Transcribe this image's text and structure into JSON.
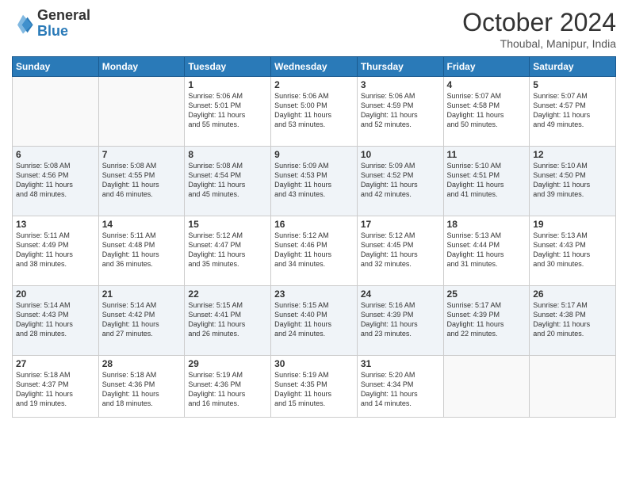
{
  "header": {
    "logo_general": "General",
    "logo_blue": "Blue",
    "month": "October 2024",
    "location": "Thoubal, Manipur, India"
  },
  "weekdays": [
    "Sunday",
    "Monday",
    "Tuesday",
    "Wednesday",
    "Thursday",
    "Friday",
    "Saturday"
  ],
  "weeks": [
    [
      {
        "day": "",
        "info": ""
      },
      {
        "day": "",
        "info": ""
      },
      {
        "day": "1",
        "info": "Sunrise: 5:06 AM\nSunset: 5:01 PM\nDaylight: 11 hours\nand 55 minutes."
      },
      {
        "day": "2",
        "info": "Sunrise: 5:06 AM\nSunset: 5:00 PM\nDaylight: 11 hours\nand 53 minutes."
      },
      {
        "day": "3",
        "info": "Sunrise: 5:06 AM\nSunset: 4:59 PM\nDaylight: 11 hours\nand 52 minutes."
      },
      {
        "day": "4",
        "info": "Sunrise: 5:07 AM\nSunset: 4:58 PM\nDaylight: 11 hours\nand 50 minutes."
      },
      {
        "day": "5",
        "info": "Sunrise: 5:07 AM\nSunset: 4:57 PM\nDaylight: 11 hours\nand 49 minutes."
      }
    ],
    [
      {
        "day": "6",
        "info": "Sunrise: 5:08 AM\nSunset: 4:56 PM\nDaylight: 11 hours\nand 48 minutes."
      },
      {
        "day": "7",
        "info": "Sunrise: 5:08 AM\nSunset: 4:55 PM\nDaylight: 11 hours\nand 46 minutes."
      },
      {
        "day": "8",
        "info": "Sunrise: 5:08 AM\nSunset: 4:54 PM\nDaylight: 11 hours\nand 45 minutes."
      },
      {
        "day": "9",
        "info": "Sunrise: 5:09 AM\nSunset: 4:53 PM\nDaylight: 11 hours\nand 43 minutes."
      },
      {
        "day": "10",
        "info": "Sunrise: 5:09 AM\nSunset: 4:52 PM\nDaylight: 11 hours\nand 42 minutes."
      },
      {
        "day": "11",
        "info": "Sunrise: 5:10 AM\nSunset: 4:51 PM\nDaylight: 11 hours\nand 41 minutes."
      },
      {
        "day": "12",
        "info": "Sunrise: 5:10 AM\nSunset: 4:50 PM\nDaylight: 11 hours\nand 39 minutes."
      }
    ],
    [
      {
        "day": "13",
        "info": "Sunrise: 5:11 AM\nSunset: 4:49 PM\nDaylight: 11 hours\nand 38 minutes."
      },
      {
        "day": "14",
        "info": "Sunrise: 5:11 AM\nSunset: 4:48 PM\nDaylight: 11 hours\nand 36 minutes."
      },
      {
        "day": "15",
        "info": "Sunrise: 5:12 AM\nSunset: 4:47 PM\nDaylight: 11 hours\nand 35 minutes."
      },
      {
        "day": "16",
        "info": "Sunrise: 5:12 AM\nSunset: 4:46 PM\nDaylight: 11 hours\nand 34 minutes."
      },
      {
        "day": "17",
        "info": "Sunrise: 5:12 AM\nSunset: 4:45 PM\nDaylight: 11 hours\nand 32 minutes."
      },
      {
        "day": "18",
        "info": "Sunrise: 5:13 AM\nSunset: 4:44 PM\nDaylight: 11 hours\nand 31 minutes."
      },
      {
        "day": "19",
        "info": "Sunrise: 5:13 AM\nSunset: 4:43 PM\nDaylight: 11 hours\nand 30 minutes."
      }
    ],
    [
      {
        "day": "20",
        "info": "Sunrise: 5:14 AM\nSunset: 4:43 PM\nDaylight: 11 hours\nand 28 minutes."
      },
      {
        "day": "21",
        "info": "Sunrise: 5:14 AM\nSunset: 4:42 PM\nDaylight: 11 hours\nand 27 minutes."
      },
      {
        "day": "22",
        "info": "Sunrise: 5:15 AM\nSunset: 4:41 PM\nDaylight: 11 hours\nand 26 minutes."
      },
      {
        "day": "23",
        "info": "Sunrise: 5:15 AM\nSunset: 4:40 PM\nDaylight: 11 hours\nand 24 minutes."
      },
      {
        "day": "24",
        "info": "Sunrise: 5:16 AM\nSunset: 4:39 PM\nDaylight: 11 hours\nand 23 minutes."
      },
      {
        "day": "25",
        "info": "Sunrise: 5:17 AM\nSunset: 4:39 PM\nDaylight: 11 hours\nand 22 minutes."
      },
      {
        "day": "26",
        "info": "Sunrise: 5:17 AM\nSunset: 4:38 PM\nDaylight: 11 hours\nand 20 minutes."
      }
    ],
    [
      {
        "day": "27",
        "info": "Sunrise: 5:18 AM\nSunset: 4:37 PM\nDaylight: 11 hours\nand 19 minutes."
      },
      {
        "day": "28",
        "info": "Sunrise: 5:18 AM\nSunset: 4:36 PM\nDaylight: 11 hours\nand 18 minutes."
      },
      {
        "day": "29",
        "info": "Sunrise: 5:19 AM\nSunset: 4:36 PM\nDaylight: 11 hours\nand 16 minutes."
      },
      {
        "day": "30",
        "info": "Sunrise: 5:19 AM\nSunset: 4:35 PM\nDaylight: 11 hours\nand 15 minutes."
      },
      {
        "day": "31",
        "info": "Sunrise: 5:20 AM\nSunset: 4:34 PM\nDaylight: 11 hours\nand 14 minutes."
      },
      {
        "day": "",
        "info": ""
      },
      {
        "day": "",
        "info": ""
      }
    ]
  ]
}
